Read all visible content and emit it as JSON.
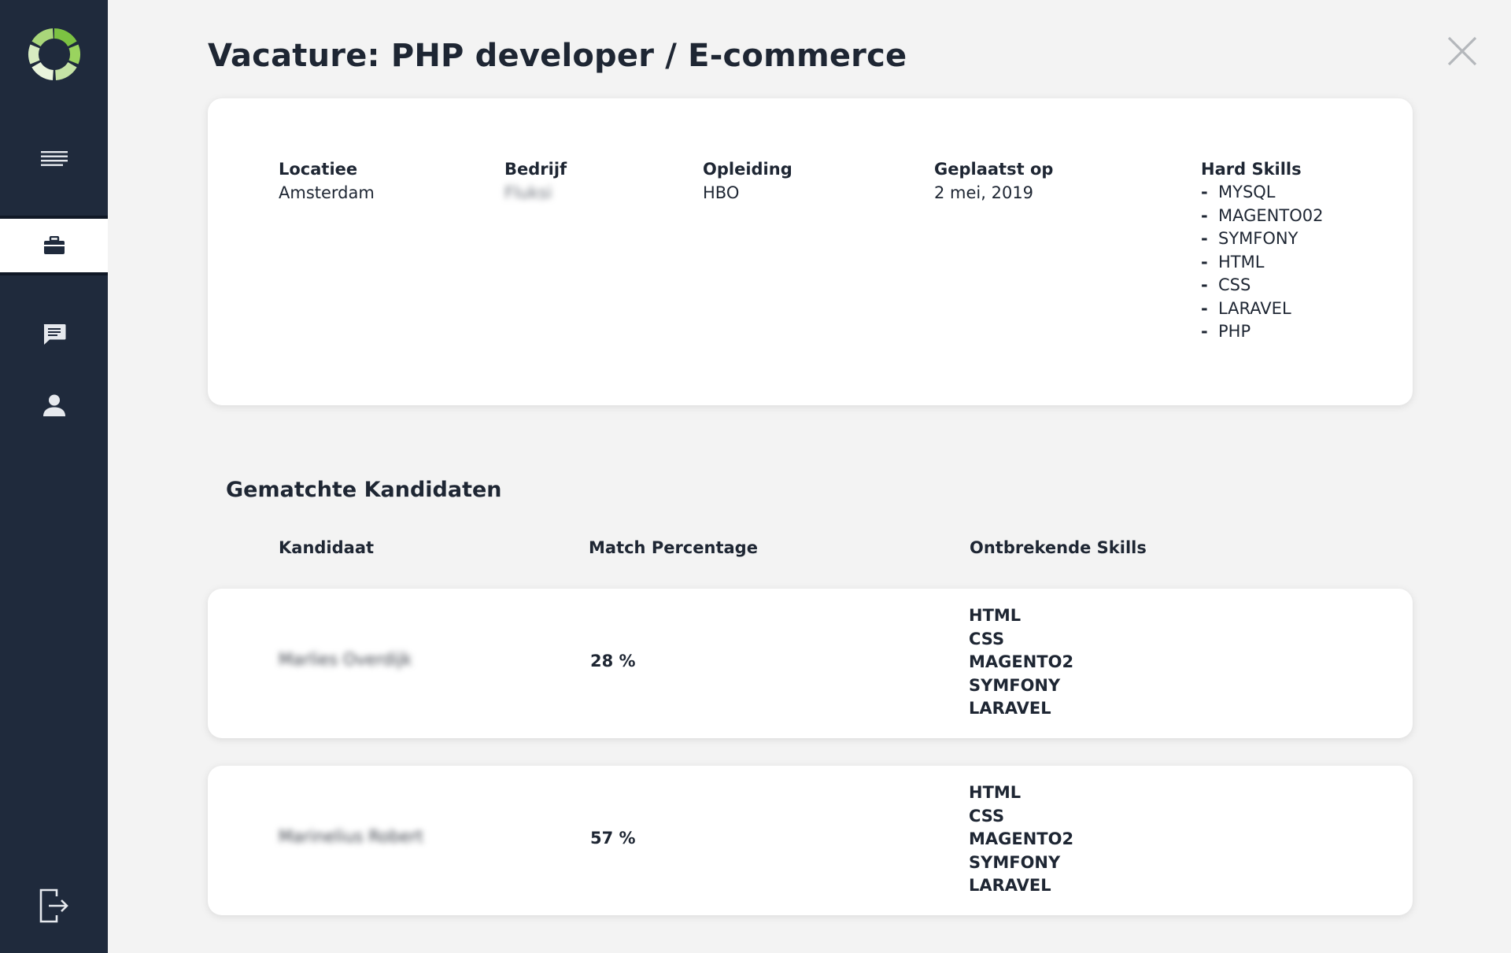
{
  "sidebar": {
    "logo": "logo-icon",
    "items": [
      {
        "name": "menu-icon",
        "active": false
      },
      {
        "name": "briefcase-icon",
        "active": true
      },
      {
        "name": "chat-icon",
        "active": false
      },
      {
        "name": "user-icon",
        "active": false
      }
    ],
    "logout": "logout-icon",
    "colors": {
      "background": "#1f2a3c",
      "accent_green": "#7cc242",
      "light_green": "#c5e3a5"
    }
  },
  "header": {
    "title": "Vacature: PHP developer / E-commerce",
    "close_icon": "close-icon"
  },
  "vacancy": {
    "location_label": "Locatiee",
    "location_value": "Amsterdam",
    "company_label": "Bedrijf",
    "company_value": "Fluksi",
    "education_label": "Opleiding",
    "education_value": "HBO",
    "posted_label": "Geplaatst op",
    "posted_value": "2 mei, 2019",
    "skills_label": "Hard Skills",
    "skills": [
      "MYSQL",
      "MAGENTO02",
      "SYMFONY",
      "HTML",
      "CSS",
      "LARAVEL",
      "PHP"
    ]
  },
  "matches": {
    "title": "Gematchte Kandidaten",
    "columns": {
      "candidate": "Kandidaat",
      "match": "Match Percentage",
      "missing": "Ontbrekende Skills"
    },
    "rows": [
      {
        "name": "Marlies Overdijk",
        "percentage": "28 %",
        "missing": [
          "HTML",
          "CSS",
          "MAGENTO2",
          "SYMFONY",
          "LARAVEL"
        ]
      },
      {
        "name": "Marinelius Robert",
        "percentage": "57 %",
        "missing": [
          "HTML",
          "CSS",
          "MAGENTO2",
          "SYMFONY",
          "LARAVEL"
        ]
      }
    ]
  }
}
